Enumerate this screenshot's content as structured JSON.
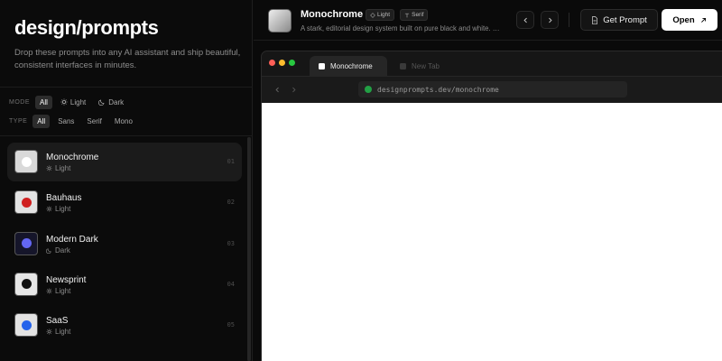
{
  "app": {
    "brand": "design/prompts",
    "tagline": "Drop these prompts into any AI assistant and ship beautiful, consistent interfaces in minutes."
  },
  "filters": {
    "mode_label": "MODE",
    "mode_options": [
      "All",
      "Light",
      "Dark"
    ],
    "mode_selected": "All",
    "type_label": "TYPE",
    "type_options": [
      "All",
      "Sans",
      "Serif",
      "Mono"
    ],
    "type_selected": "All"
  },
  "prompts": [
    {
      "title": "Monochrome",
      "mode": "Light",
      "num": "01",
      "thumb_bg": "#d9d9d9",
      "dot": "#ffffff",
      "selected": true
    },
    {
      "title": "Bauhaus",
      "mode": "Light",
      "num": "02",
      "thumb_bg": "#e3e3e3",
      "dot": "#d02020",
      "selected": false
    },
    {
      "title": "Modern Dark",
      "mode": "Dark",
      "num": "03",
      "thumb_bg": "#15152a",
      "dot": "#6366f1",
      "selected": false
    },
    {
      "title": "Newsprint",
      "mode": "Light",
      "num": "04",
      "thumb_bg": "#e6e6e6",
      "dot": "#111111",
      "selected": false
    },
    {
      "title": "SaaS",
      "mode": "Light",
      "num": "05",
      "thumb_bg": "#e3e3e3",
      "dot": "#2563eb",
      "selected": false
    }
  ],
  "header": {
    "title": "Monochrome",
    "tags": [
      "Light",
      "Serif"
    ],
    "description": "A stark, editorial design system built on pure black and white. …",
    "get_prompt_label": "Get Prompt",
    "open_label": "Open"
  },
  "browser": {
    "tabs": [
      {
        "label": "Monochrome",
        "active": true
      },
      {
        "label": "New Tab",
        "active": false
      }
    ],
    "url": "designprompts.dev/monochrome"
  },
  "colors": {
    "accent": "#ffffff",
    "background": "#0a0a0a",
    "traffic_red": "#ff5f57",
    "traffic_yellow": "#febc2e",
    "traffic_green": "#28c840",
    "secure": "#22a045"
  }
}
